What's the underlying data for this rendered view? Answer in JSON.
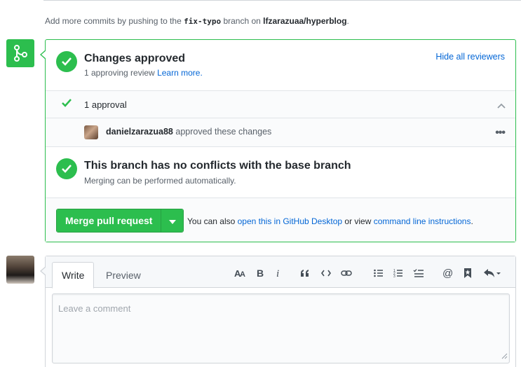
{
  "info": {
    "prefix": "Add more commits by pushing to the",
    "branch": "fix-typo",
    "middle": "branch on",
    "repo": "lfzarazuaa/hyperblog",
    "suffix": "."
  },
  "approved": {
    "title": "Changes approved",
    "subtitle": "1 approving review",
    "learn_more": "Learn more.",
    "hide_reviewers": "Hide all reviewers"
  },
  "approval_summary": {
    "label": "1 approval"
  },
  "reviewer": {
    "username": "danielzarazua88",
    "action": "approved these changes",
    "menu": "•••"
  },
  "conflicts": {
    "title": "This branch has no conflicts with the base branch",
    "subtitle": "Merging can be performed automatically."
  },
  "merge": {
    "button_label": "Merge pull request",
    "help_prefix": "You can also",
    "desktop_link": "open this in GitHub Desktop",
    "help_middle": "or view",
    "cli_link": "command line instructions",
    "help_suffix": "."
  },
  "comment": {
    "tab_write": "Write",
    "tab_preview": "Preview",
    "placeholder": "Leave a comment"
  },
  "toolbar_icons": [
    "text-size-icon",
    "bold-icon",
    "italic-icon",
    "quote-icon",
    "code-icon",
    "link-icon",
    "bulleted-list-icon",
    "numbered-list-icon",
    "task-list-icon",
    "mention-icon",
    "saved-reply-icon",
    "reply-icon"
  ],
  "colors": {
    "success": "#2cbe4e",
    "link": "#0366d6",
    "muted": "#586069"
  }
}
